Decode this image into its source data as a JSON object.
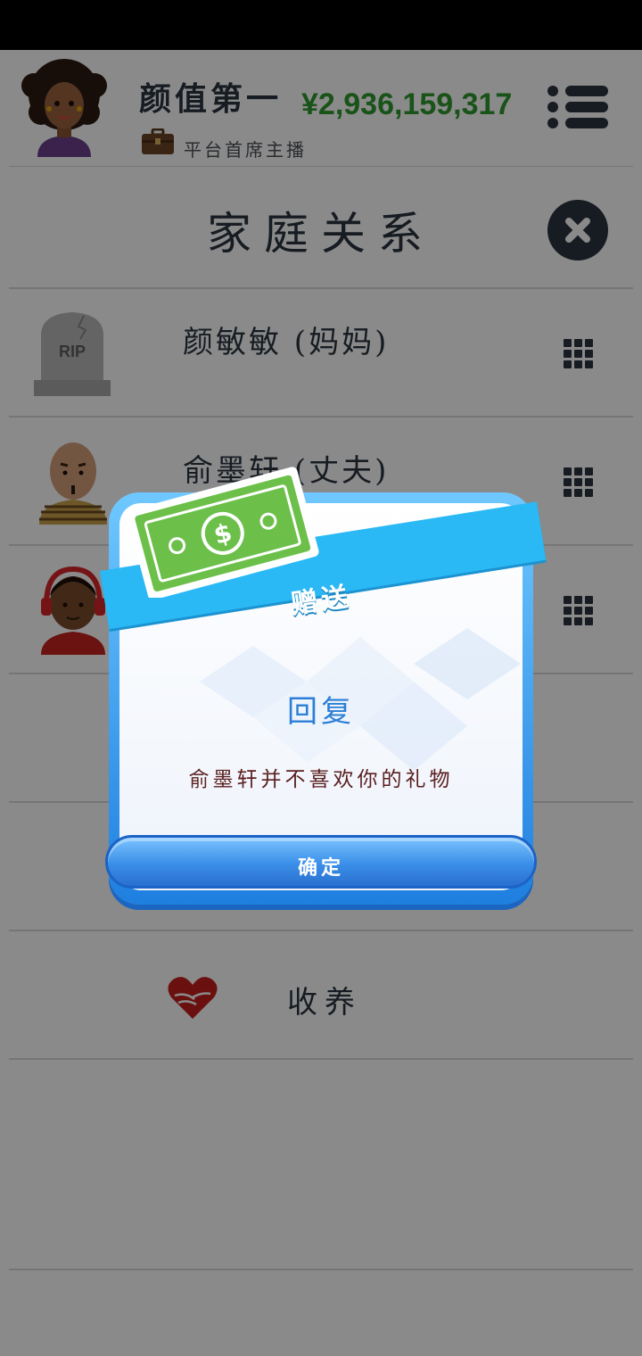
{
  "header": {
    "username": "颜值第一",
    "job_title": "平台首席主播",
    "money": "¥2,936,159,317",
    "money_color": "#2f9a2f",
    "avatar_icon": "woman-curly-hair-avatar",
    "job_icon": "briefcase-icon",
    "menu_icon": "menu-list-icon"
  },
  "page": {
    "title": "家庭关系",
    "close_icon": "close-icon"
  },
  "members": [
    {
      "name": "颜敏敏 (妈妈)",
      "icon": "rip-tombstone-icon",
      "icon_text": "RIP"
    },
    {
      "name": "俞墨轩 (丈夫)",
      "icon": "bald-man-avatar"
    },
    {
      "name": "",
      "icon": "headphones-man-avatar"
    }
  ],
  "adopt": {
    "label": "收养",
    "icon": "heart-hands-icon"
  },
  "dialog": {
    "ribbon_title": "赠送",
    "title": "回复",
    "message": "俞墨轩并不喜欢你的礼物",
    "ok_label": "确定",
    "bill_icon": "dollar-bill-icon"
  }
}
